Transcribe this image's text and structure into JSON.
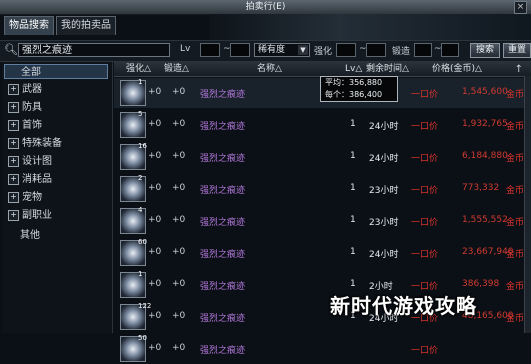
{
  "window": {
    "title": "拍卖行(E)",
    "close": "×"
  },
  "tabs": [
    {
      "label": "物品搜索"
    },
    {
      "label": "我的拍卖品"
    }
  ],
  "search": {
    "icon": "search-icon",
    "value": "强烈之痕迹",
    "lv_label": "Lv",
    "sep1": "~",
    "rarity_value": "稀有度",
    "enhance_label": "强化",
    "sep2": "~",
    "forge_label": "锻造",
    "sep3": "~",
    "search_button": "搜索",
    "reset_button": "重置"
  },
  "sidebar": {
    "items": [
      {
        "label": "全部",
        "plus": false,
        "active": true
      },
      {
        "label": "武器",
        "plus": true
      },
      {
        "label": "防具",
        "plus": true
      },
      {
        "label": "首饰",
        "plus": true
      },
      {
        "label": "特殊装备",
        "plus": true
      },
      {
        "label": "设计图",
        "plus": true
      },
      {
        "label": "消耗品",
        "plus": true
      },
      {
        "label": "宠物",
        "plus": true
      },
      {
        "label": "副职业",
        "plus": true
      },
      {
        "label": "其他",
        "plus": false
      }
    ]
  },
  "table": {
    "headers": {
      "enhance": "强化△",
      "forge": "锻造△",
      "name": "名称△",
      "level": "Lv△",
      "remaining": "剩余时间△",
      "price": "价格(金币)△",
      "pin": "↑"
    },
    "rows": [
      {
        "lvl": "1",
        "enh": "+0",
        "forge": "+0",
        "name": "强烈之痕迹",
        "qty": "",
        "time": "",
        "fixed": "一口价",
        "price": "1,545,600",
        "unit": "金币"
      },
      {
        "lvl": "5",
        "enh": "+0",
        "forge": "+0",
        "name": "强烈之痕迹",
        "qty": "1",
        "time": "24小时",
        "fixed": "一口价",
        "price": "1,932,765",
        "unit": "金币"
      },
      {
        "lvl": "16",
        "enh": "+0",
        "forge": "+0",
        "name": "强烈之痕迹",
        "qty": "1",
        "time": "24小时",
        "fixed": "一口价",
        "price": "6,184,880",
        "unit": "金币"
      },
      {
        "lvl": "2",
        "enh": "+0",
        "forge": "+0",
        "name": "强烈之痕迹",
        "qty": "1",
        "time": "23小时",
        "fixed": "一口价",
        "price": "773,332",
        "unit": "金币"
      },
      {
        "lvl": "4",
        "enh": "+0",
        "forge": "+0",
        "name": "强烈之痕迹",
        "qty": "1",
        "time": "23小时",
        "fixed": "一口价",
        "price": "1,555,552",
        "unit": "金币"
      },
      {
        "lvl": "60",
        "enh": "+0",
        "forge": "+0",
        "name": "强烈之痕迹",
        "qty": "1",
        "time": "24小时",
        "fixed": "一口价",
        "price": "23,667,940",
        "unit": "金币"
      },
      {
        "lvl": "1",
        "enh": "+0",
        "forge": "+0",
        "name": "强烈之痕迹",
        "qty": "1",
        "time": "2小时",
        "fixed": "一口价",
        "price": "386,398",
        "unit": "金币"
      },
      {
        "lvl": "122",
        "enh": "+0",
        "forge": "+0",
        "name": "强烈之痕迹",
        "qty": "1",
        "time": "24小时",
        "fixed": "一口价",
        "price": "48,165,600",
        "unit": "金币"
      },
      {
        "lvl": "50",
        "enh": "+0",
        "forge": "+0",
        "name": "强烈之痕迹",
        "qty": "",
        "time": "",
        "fixed": "一口价",
        "price": "",
        "unit": ""
      }
    ]
  },
  "tooltip": {
    "avg_label": "平均：",
    "avg_value": "356,880",
    "each_label": "每个：",
    "each_value": "386,400"
  },
  "watermark": "新时代游戏攻略"
}
